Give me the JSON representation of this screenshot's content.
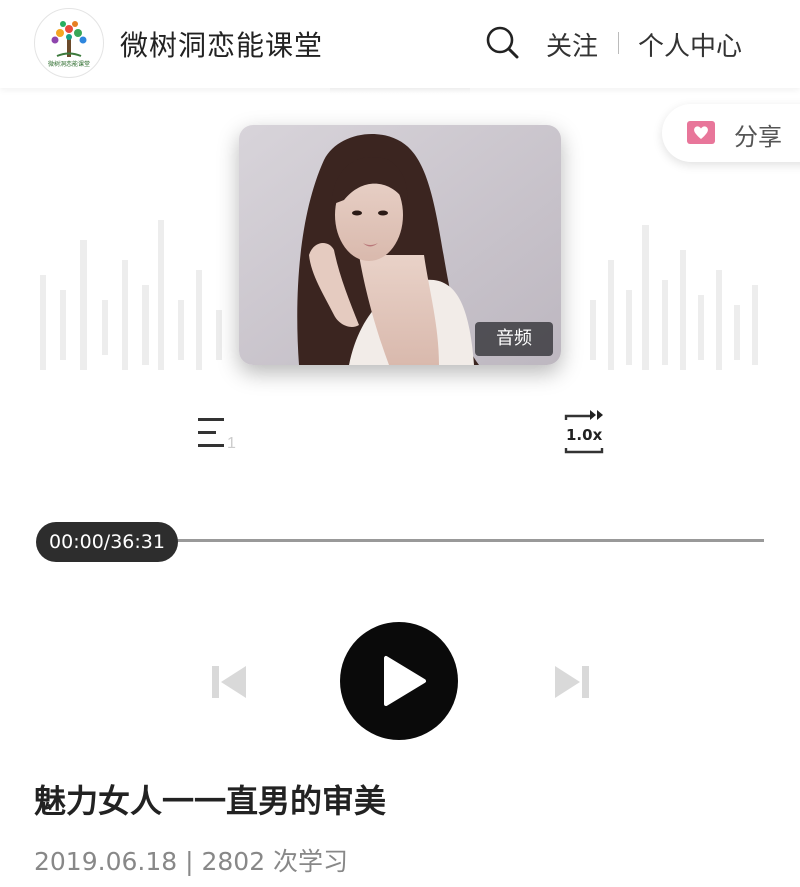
{
  "header": {
    "logo_caption": "微树洞恋能课堂",
    "brand": "微树洞恋能课堂",
    "follow_label": "关注",
    "profile_label": "个人中心"
  },
  "share": {
    "label": "分享",
    "icon": "heart-envelope-icon"
  },
  "cover": {
    "tag": "音频"
  },
  "controls": {
    "playlist_count": "1",
    "speed": "1.0x"
  },
  "progress": {
    "time": "00:00/36:31",
    "fraction": 0
  },
  "course": {
    "title": "魅力女人一一直男的审美",
    "date": "2019.06.18",
    "separator": "|",
    "learners": "2802 次学习"
  },
  "colors": {
    "accent_pink": "#e8769a",
    "play_button": "#0a0a0a",
    "time_pill": "#2d2d2d"
  }
}
